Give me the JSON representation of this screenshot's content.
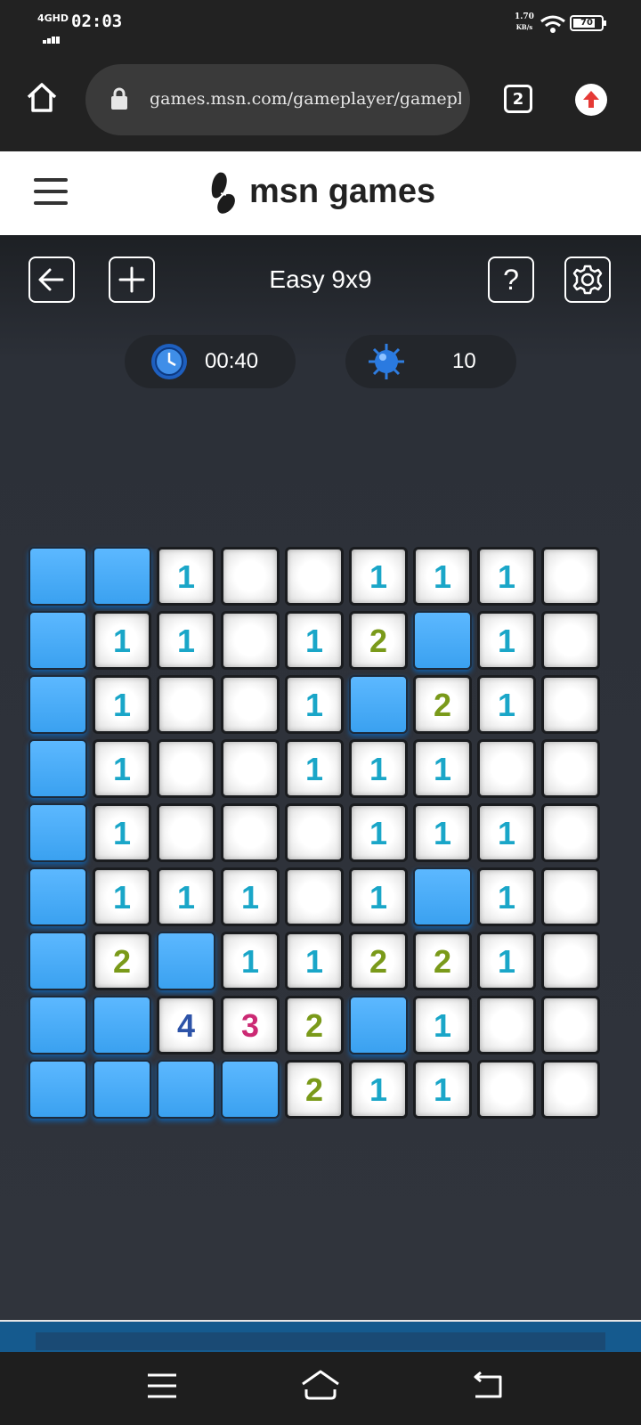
{
  "status_bar": {
    "network": "4GHD",
    "time": "02:03",
    "speed_value": "1.70",
    "speed_unit": "KB/s",
    "battery": "70"
  },
  "browser": {
    "url": "games.msn.com/gameplayer/gameplay",
    "tab_count": "2"
  },
  "site": {
    "brand": "msn games"
  },
  "game": {
    "title": "Easy 9x9",
    "timer": "00:40",
    "mines": "10",
    "board": [
      [
        "H",
        "H",
        "1",
        "0",
        "0",
        "1",
        "1",
        "1",
        "0"
      ],
      [
        "H",
        "1",
        "1",
        "0",
        "1",
        "2",
        "H",
        "1",
        "0"
      ],
      [
        "H",
        "1",
        "0",
        "0",
        "1",
        "H",
        "2",
        "1",
        "0"
      ],
      [
        "H",
        "1",
        "0",
        "0",
        "1",
        "1",
        "1",
        "0",
        "0"
      ],
      [
        "H",
        "1",
        "0",
        "0",
        "0",
        "1",
        "1",
        "1",
        "0"
      ],
      [
        "H",
        "1",
        "1",
        "1",
        "0",
        "1",
        "H",
        "1",
        "0"
      ],
      [
        "H",
        "2",
        "H",
        "1",
        "1",
        "2",
        "2",
        "1",
        "0"
      ],
      [
        "H",
        "H",
        "4",
        "3",
        "2",
        "H",
        "1",
        "0",
        "0"
      ],
      [
        "H",
        "H",
        "H",
        "H",
        "2",
        "1",
        "1",
        "0",
        "0"
      ]
    ]
  },
  "icons": {
    "home": "home-icon",
    "lock": "lock-icon",
    "back": "arrow-left-icon",
    "new_game": "plus-icon",
    "help": "question-icon",
    "settings": "gear-icon",
    "timer": "clock-icon",
    "mines": "mine-icon"
  },
  "colors": {
    "hidden_tile": "#4aaef7",
    "number_1": "#1aa6c8",
    "number_2": "#7a9a1a",
    "number_3": "#cc2a74",
    "number_4": "#2d53a8"
  }
}
